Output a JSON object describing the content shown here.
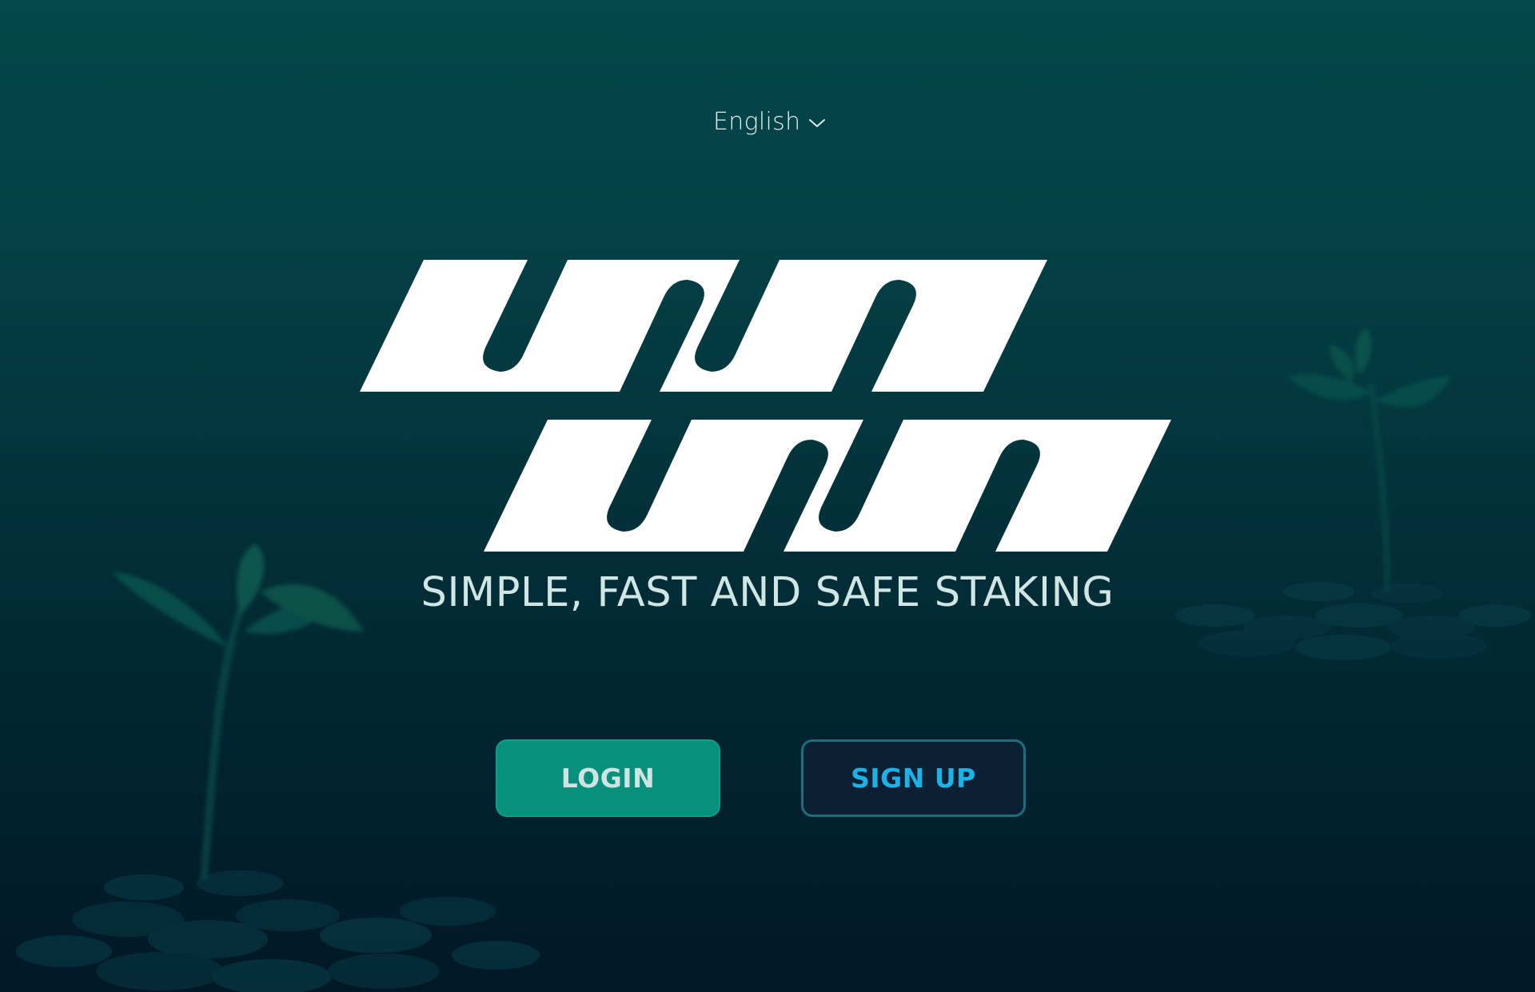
{
  "language_selector": {
    "label": "English",
    "icon": "chevron-down-icon"
  },
  "logo": {
    "icon": "brand-logo"
  },
  "hero": {
    "tagline": "SIMPLE, FAST AND SAFE STAKING"
  },
  "actions": {
    "login_label": "LOGIN",
    "signup_label": "SIGN UP"
  },
  "colors": {
    "background_top": "#05474a",
    "background_bottom": "#011827",
    "login_bg": "#07907c",
    "signup_text": "#1bb2e8",
    "signup_border": "#1e6f7c"
  }
}
